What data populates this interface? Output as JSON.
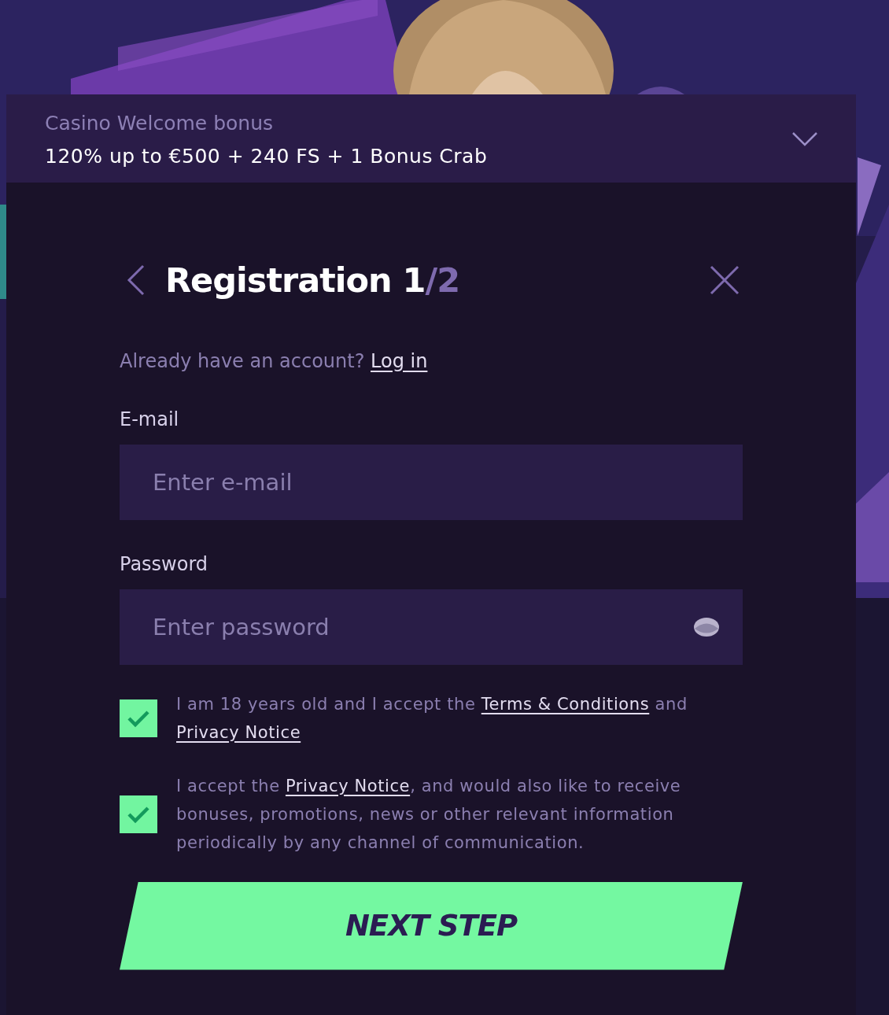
{
  "bonus": {
    "label": "Casino Welcome bonus",
    "offer": "120% up to €500 + 240 FS + 1 Bonus Crab",
    "expanded": false
  },
  "header": {
    "title": "Registration",
    "step": "1",
    "total": "/2"
  },
  "login_prompt": {
    "text": "Already have an account?",
    "link": "Log in"
  },
  "fields": [
    {
      "label": "E-mail",
      "placeholder": "Enter e-mail",
      "kind": "email"
    },
    {
      "label": "Password",
      "placeholder": "Enter password",
      "kind": "password"
    }
  ],
  "consents": [
    {
      "checked": true,
      "parts": [
        {
          "kind": "text",
          "text": "I am 18 years old and I accept the "
        },
        {
          "kind": "link",
          "text": "Terms & Conditions"
        },
        {
          "kind": "text",
          "text": " and "
        },
        {
          "kind": "link",
          "text": "Privacy Notice"
        }
      ]
    },
    {
      "checked": true,
      "parts": [
        {
          "kind": "text",
          "text": "I accept the "
        },
        {
          "kind": "link",
          "text": "Privacy Notice"
        },
        {
          "kind": "text",
          "text": ", and would also like to receive bonuses, promotions, news or other relevant information periodically by any channel of communication."
        }
      ]
    }
  ],
  "submit": "NEXT STEP"
}
